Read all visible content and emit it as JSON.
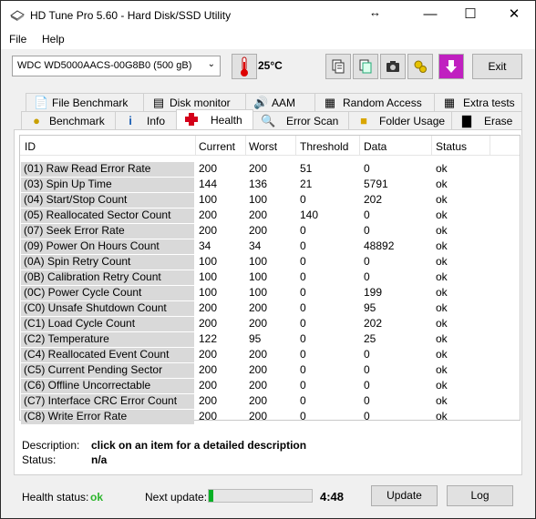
{
  "window": {
    "title": "HD Tune Pro 5.60 - Hard Disk/SSD Utility"
  },
  "titlebar": {
    "move_glyph": "↔",
    "minimize": "—",
    "maximize": "☐",
    "close": "✕"
  },
  "menu": {
    "file": "File",
    "help": "Help"
  },
  "toolbar": {
    "drive": "WDC WD5000AACS-00G8B0 (500 gB)",
    "temperature": "25°C",
    "exit_label": "Exit",
    "icons": [
      "copy-info-icon",
      "copy-screen-icon",
      "camera-icon",
      "options-icon",
      "save-icon"
    ]
  },
  "tabs_top": [
    {
      "label": "File Benchmark",
      "icon": "file-benchmark-icon"
    },
    {
      "label": "Disk monitor",
      "icon": "disk-monitor-icon"
    },
    {
      "label": "AAM",
      "icon": "speaker-icon"
    },
    {
      "label": "Random Access",
      "icon": "random-access-icon"
    },
    {
      "label": "Extra tests",
      "icon": "extra-tests-icon"
    }
  ],
  "tabs_bottom": [
    {
      "label": "Benchmark",
      "icon": "benchmark-icon"
    },
    {
      "label": "Info",
      "icon": "info-icon"
    },
    {
      "label": "Health",
      "icon": "health-cross-icon"
    },
    {
      "label": "Error Scan",
      "icon": "magnifier-icon"
    },
    {
      "label": "Folder Usage",
      "icon": "folder-icon"
    },
    {
      "label": "Erase",
      "icon": "trash-icon"
    }
  ],
  "table": {
    "headers": [
      "ID",
      "Current",
      "Worst",
      "Threshold",
      "Data",
      "Status"
    ],
    "rows": [
      [
        "(01) Raw Read Error Rate",
        "200",
        "200",
        "51",
        "0",
        "ok"
      ],
      [
        "(03) Spin Up Time",
        "144",
        "136",
        "21",
        "5791",
        "ok"
      ],
      [
        "(04) Start/Stop Count",
        "100",
        "100",
        "0",
        "202",
        "ok"
      ],
      [
        "(05) Reallocated Sector Count",
        "200",
        "200",
        "140",
        "0",
        "ok"
      ],
      [
        "(07) Seek Error Rate",
        "200",
        "200",
        "0",
        "0",
        "ok"
      ],
      [
        "(09) Power On Hours Count",
        "34",
        "34",
        "0",
        "48892",
        "ok"
      ],
      [
        "(0A) Spin Retry Count",
        "100",
        "100",
        "0",
        "0",
        "ok"
      ],
      [
        "(0B) Calibration Retry Count",
        "100",
        "100",
        "0",
        "0",
        "ok"
      ],
      [
        "(0C) Power Cycle Count",
        "100",
        "100",
        "0",
        "199",
        "ok"
      ],
      [
        "(C0) Unsafe Shutdown Count",
        "200",
        "200",
        "0",
        "95",
        "ok"
      ],
      [
        "(C1) Load Cycle Count",
        "200",
        "200",
        "0",
        "202",
        "ok"
      ],
      [
        "(C2) Temperature",
        "122",
        "95",
        "0",
        "25",
        "ok"
      ],
      [
        "(C4) Reallocated Event Count",
        "200",
        "200",
        "0",
        "0",
        "ok"
      ],
      [
        "(C5) Current Pending Sector",
        "200",
        "200",
        "0",
        "0",
        "ok"
      ],
      [
        "(C6) Offline Uncorrectable",
        "200",
        "200",
        "0",
        "0",
        "ok"
      ],
      [
        "(C7) Interface CRC Error Count",
        "200",
        "200",
        "0",
        "0",
        "ok"
      ],
      [
        "(C8) Write Error Rate",
        "200",
        "200",
        "0",
        "0",
        "ok"
      ]
    ]
  },
  "description": {
    "label": "Description:",
    "value": "click on an item for a detailed description",
    "status_label": "Status:",
    "status_value": "n/a"
  },
  "footer": {
    "health_label": "Health status:",
    "health_value": "ok",
    "next_update_label": "Next update:",
    "progress": 0.04,
    "timer": "4:48",
    "update_label": "Update",
    "log_label": "Log"
  },
  "colors": {
    "ok_green": "#2bb52b",
    "progress_green": "#06b025",
    "id_cell_bg": "#d9d9d9"
  }
}
